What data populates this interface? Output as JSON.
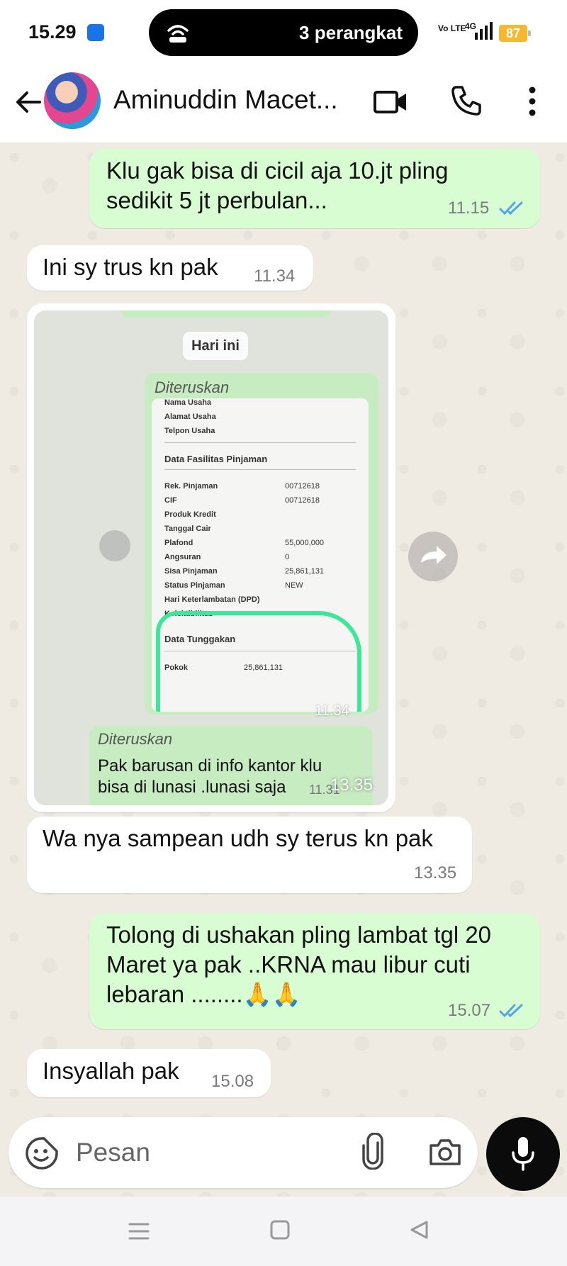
{
  "status_bar": {
    "time": "15.29",
    "hotspot_text": "3 perangkat",
    "network_badge": "Vo LTE",
    "network_type": "4G",
    "battery": "87",
    "battery_color": "#f5b82e"
  },
  "header": {
    "contact_name": "Aminuddin Macet..."
  },
  "messages": [
    {
      "id": "m1",
      "direction": "out",
      "text": "Klu gak bisa di cicil aja 10.jt pling sedikit 5 jt perbulan...",
      "time": "11.15",
      "read": true
    },
    {
      "id": "m2",
      "direction": "in",
      "text": "Ini sy trus kn pak",
      "time": "11.34"
    },
    {
      "id": "m3",
      "direction": "in",
      "type": "image",
      "time": "13.35",
      "image": {
        "date_pill": "Hari ini",
        "forwarded_label": "Diteruskan",
        "doc_rows": [
          {
            "label": "Nama Usaha",
            "value": ""
          },
          {
            "label": "Alamat Usaha",
            "value": ""
          },
          {
            "label": "Telpon Usaha",
            "value": ""
          },
          {
            "label": "Rek. Pinjaman",
            "value": "00712618"
          },
          {
            "label": "CIF",
            "value": "00712618"
          },
          {
            "label": "Produk Kredit",
            "value": ""
          },
          {
            "label": "Tanggal Cair",
            "value": ""
          },
          {
            "label": "Plafond",
            "value": "55,000,000"
          },
          {
            "label": "Angsuran",
            "value": "0"
          },
          {
            "label": "Sisa Pinjaman",
            "value": "25,861,131"
          },
          {
            "label": "Status Pinjaman",
            "value": "NEW"
          },
          {
            "label": "Hari Keterlambatan (DPD)",
            "value": ""
          },
          {
            "label": "Kolektibilitas",
            "value": ""
          },
          {
            "label": "Pokok",
            "value": "25,861,131"
          }
        ],
        "doc_section_1": "Data Fasilitas Pinjaman",
        "doc_section_2": "Data Tunggakan",
        "inner_time_1": "11.34",
        "forwarded_label_2": "Diteruskan",
        "inner_message": "Pak barusan di info kantor klu bisa di lunasi .lunasi saja",
        "inner_time_2": "11.31"
      }
    },
    {
      "id": "m4",
      "direction": "in",
      "text": "Wa nya sampean udh sy terus kn pak",
      "time": "13.35"
    },
    {
      "id": "m5",
      "direction": "out",
      "text": "Tolong di ushakan pling lambat tgl 20 Maret  ya pak  ..KRNA mau libur cuti lebaran ........🙏🙏",
      "time": "15.07",
      "read": true
    },
    {
      "id": "m6",
      "direction": "in",
      "text": "Insyallah pak",
      "time": "15.08"
    }
  ],
  "composer": {
    "placeholder": "Pesan"
  },
  "icons": {
    "back": "arrow-left-icon",
    "video": "video-camera-icon",
    "call": "phone-icon",
    "more": "more-vertical-icon",
    "sticker": "sticker-icon",
    "attach": "paperclip-icon",
    "camera": "camera-icon",
    "mic": "microphone-icon",
    "forward": "forward-icon"
  },
  "colors": {
    "outgoing_bubble": "#d9fdd3",
    "incoming_bubble": "#ffffff",
    "chat_background": "#efeae2",
    "read_tick": "#53a6e8",
    "mic_button": "#0b0b0b"
  }
}
